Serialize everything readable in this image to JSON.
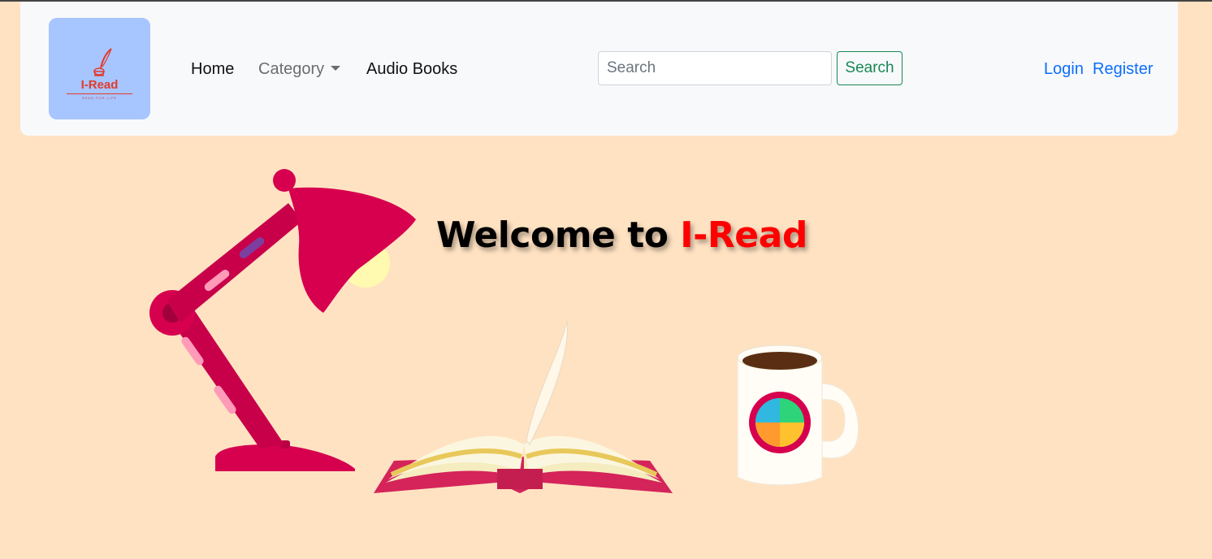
{
  "brand": {
    "logo_text": "I-Read",
    "tagline": "READ FOR LIFE",
    "bg_color": "#a7c5ff",
    "text_color": "#e23b2a"
  },
  "nav": {
    "home": "Home",
    "category": "Category",
    "audio_books": "Audio Books"
  },
  "search": {
    "placeholder": "Search",
    "value": "",
    "button_label": "Search"
  },
  "auth": {
    "login": "Login",
    "register": "Register"
  },
  "hero": {
    "welcome_prefix": "Welcome to",
    "welcome_brand": "I-Read",
    "accent_color": "#ff0000"
  },
  "colors": {
    "page_bg": "#ffe2c2",
    "navbar_bg": "#f8f9fb",
    "link_color": "#0d6efd",
    "search_btn_color": "#198754",
    "lamp_color": "#d6004f"
  }
}
